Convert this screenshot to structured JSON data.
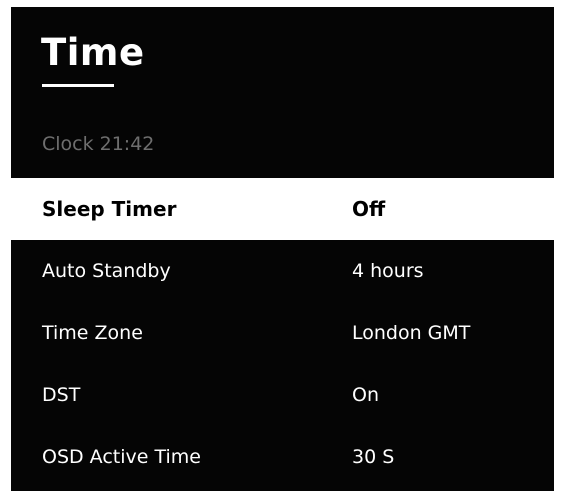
{
  "screen": {
    "title": "Time",
    "clock_label": "Clock",
    "clock_time": "21:42"
  },
  "menu": {
    "selected_index": 0,
    "items": [
      {
        "label": "Sleep Timer",
        "value": "Off"
      },
      {
        "label": "Auto Standby",
        "value": "4 hours"
      },
      {
        "label": "Time Zone",
        "value": "London GMT"
      },
      {
        "label": "DST",
        "value": "On"
      },
      {
        "label": "OSD Active Time",
        "value": "30 S"
      }
    ]
  },
  "colors": {
    "background": "#050505",
    "text": "#ffffff",
    "muted_text": "#6e6e6e",
    "highlight_background": "#ffffff",
    "highlight_text": "#000000"
  }
}
